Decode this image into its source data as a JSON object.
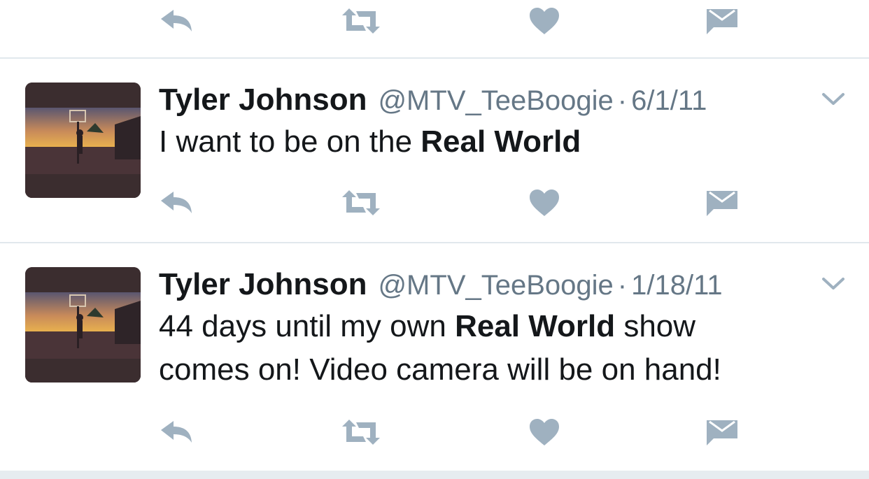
{
  "colors": {
    "icon": "#9fb1c0",
    "divider": "#e1e8ed",
    "name": "#14171a",
    "meta": "#657786"
  },
  "icons": [
    "reply-icon",
    "retweet-icon",
    "like-icon",
    "direct-message-icon",
    "chevron-down-icon"
  ],
  "tweets": [
    {
      "name": "Tyler Johnson",
      "handle": "@MTV_TeeBoogie",
      "separator": "·",
      "date": "6/1/11",
      "lines": [
        {
          "pre": "I want to be on the ",
          "bold": "Real World",
          "post": ""
        }
      ]
    },
    {
      "name": "Tyler Johnson",
      "handle": "@MTV_TeeBoogie",
      "separator": "·",
      "date": "1/18/11",
      "lines": [
        {
          "pre": "44 days until my own ",
          "bold": "Real World",
          "post": " show"
        },
        {
          "pre": "comes on! Video camera will be on hand!",
          "bold": "",
          "post": ""
        }
      ]
    }
  ]
}
